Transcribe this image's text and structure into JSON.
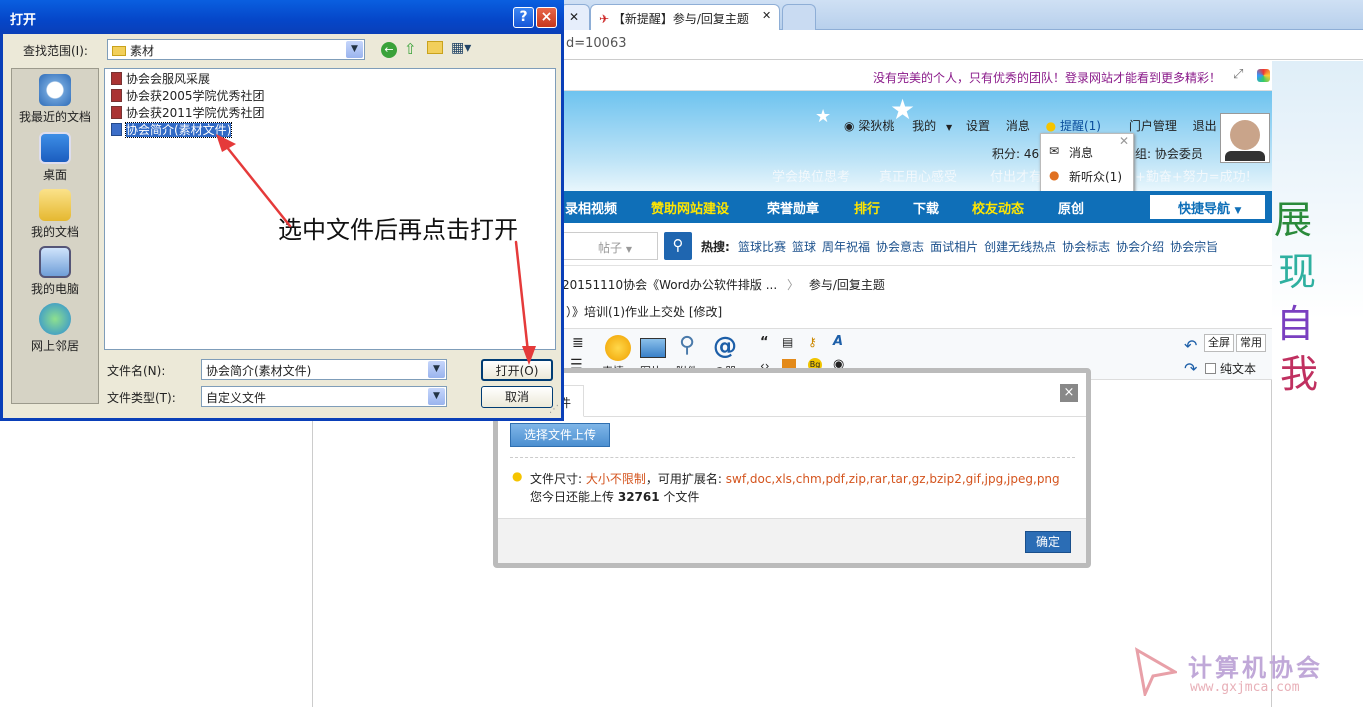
{
  "browser": {
    "tabs": [
      {
        "label": ""
      },
      {
        "label": "【新提醒】参与/回复主题"
      }
    ],
    "address_fragment": "d=10063"
  },
  "site": {
    "slogan": "没有完美的个人，只有优秀的团队！登录网站才能看到更多精彩！",
    "user": {
      "name": "梁狄桃",
      "my": "我的",
      "settings": "设置",
      "messages": "消息",
      "reminders": "提醒(1)",
      "portal": "门户管理",
      "logout": "退出",
      "points_label": "积分: 46",
      "group_suffix": "组: 协会委员"
    },
    "notif_popup": {
      "item1": "消息",
      "item2": "新听众(1)"
    },
    "mottos": [
      "学会换位思考",
      "真正用心感受",
      "付出才有",
      "+勤奋+努力=成功!"
    ],
    "nav": [
      "录相视频",
      "赞助网站建设",
      "荣誉勋章",
      "排行",
      "下载",
      "校友动态",
      "原创"
    ],
    "quick_nav": "快捷导航",
    "search_select": "帖子",
    "hotwords_label": "热搜:",
    "hotwords": [
      "篮球比赛",
      "篮球",
      "周年祝福",
      "协会意志",
      "面试相片",
      "创建无线热点",
      "协会标志",
      "协会介绍",
      "协会宗旨"
    ],
    "breadcrumb": [
      "20151110协会《Word办公软件排版 ...",
      "参与/回复主题"
    ],
    "post_title": "）》培训(1)作业上交处 [修改]",
    "editor": {
      "emoji": "表情",
      "image": "图片",
      "attach": "附件",
      "at": "@朋",
      "fullscreen": "全屏",
      "common": "常用",
      "plaintext": "纯文本"
    },
    "side_art": [
      "展",
      "现",
      "自",
      "我"
    ],
    "watermark": {
      "title": "计算机协会",
      "url": "www.gxjmca.com"
    }
  },
  "upload_dialog": {
    "tab": "件",
    "choose_button": "选择文件上传",
    "size_label": "文件尺寸:",
    "size_value": "大小不限制",
    "ext_label": "，可用扩展名:",
    "ext_value": "swf,doc,xls,chm,pdf,zip,rar,tar,gz,bzip2,gif,jpg,jpeg,png",
    "today_prefix": "您今日还能上传",
    "today_count": "32761",
    "today_suffix": "个文件",
    "ok_button": "确定",
    "close": "×"
  },
  "file_dialog": {
    "title": "打开",
    "help": "?",
    "close": "×",
    "lookin_label": "查找范围(I):",
    "lookin_value": "素材",
    "places": [
      "我最近的文档",
      "桌面",
      "我的文档",
      "我的电脑",
      "网上邻居"
    ],
    "files": [
      "协会会服风采展",
      "协会获2005学院优秀社团",
      "协会获2011学院优秀社团",
      "协会简介(素材文件)"
    ],
    "filename_label": "文件名(N):",
    "filename_value": "协会简介(素材文件)",
    "filetype_label": "文件类型(T):",
    "filetype_value": "自定义文件",
    "open_button": "打开(O)",
    "cancel_button": "取消"
  },
  "annotation": "选中文件后再点击打开",
  "colors": {
    "nav_blue": "#0f6fb8",
    "xp_title": "#0546c8",
    "arrow_red": "#e53a3a",
    "slogan_purple": "#8a1a8a",
    "link_orange": "#d4541e"
  }
}
